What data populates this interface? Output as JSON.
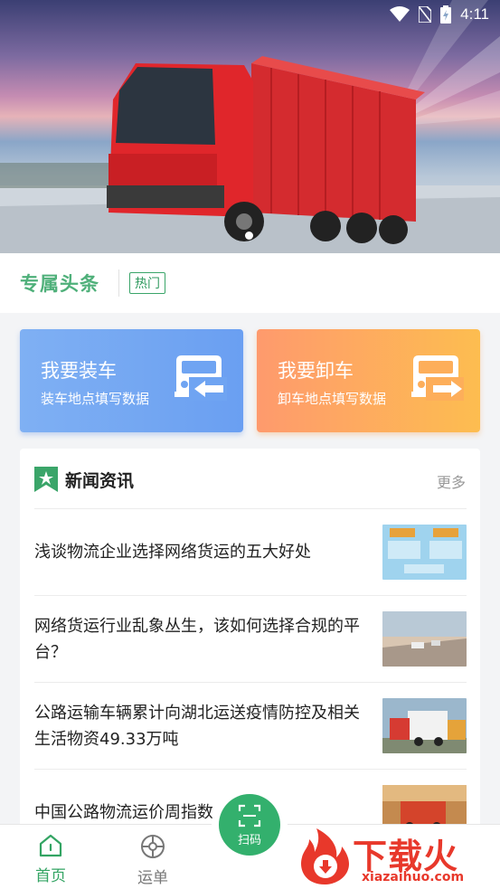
{
  "status_bar": {
    "time": "4:11"
  },
  "headline": {
    "title": "专属头条",
    "tag": "热门"
  },
  "actions": [
    {
      "title": "我要装车",
      "subtitle": "装车地点填写数据"
    },
    {
      "title": "我要卸车",
      "subtitle": "卸车地点填写数据"
    }
  ],
  "news": {
    "title": "新闻资讯",
    "more": "更多",
    "items": [
      {
        "text": "浅谈物流企业选择网络货运的五大好处"
      },
      {
        "text": "网络货运行业乱象丛生，该如何选择合规的平台？"
      },
      {
        "text": "公路运输车辆累计向湖北运送疫情防控及相关生活物资49.33万吨"
      },
      {
        "text": "中国公路物流运价周指数"
      }
    ]
  },
  "tabbar": {
    "home": "首页",
    "orders": "运单",
    "scan": "扫码"
  },
  "watermark": {
    "text": "下载火",
    "url": "xiazaihuo.com"
  },
  "colors": {
    "accent": "#33a463",
    "load_card": "#6a9ff2",
    "unload_card": "#fdae5a",
    "watermark": "#e8382b"
  }
}
